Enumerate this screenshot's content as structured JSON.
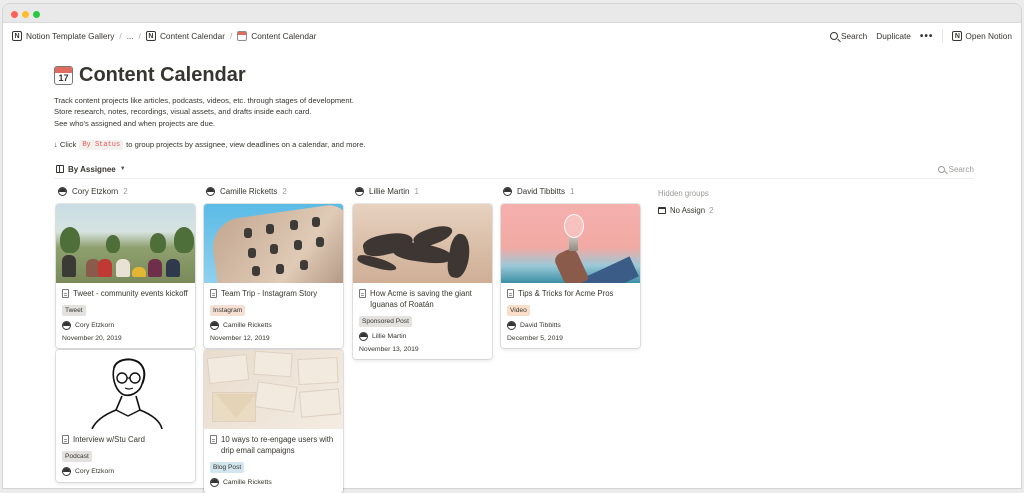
{
  "breadcrumbs": {
    "gallery": "Notion Template Gallery",
    "ellipsis": "...",
    "parent": "Content Calendar",
    "current": "Content Calendar"
  },
  "topbar": {
    "search": "Search",
    "duplicate": "Duplicate",
    "more": "•••",
    "open": "Open Notion"
  },
  "page": {
    "title": "Content Calendar",
    "desc1": "Track content projects like articles, podcasts, videos, etc. through stages of development.",
    "desc2": "Store research, notes, recordings, visual assets, and drafts inside each card.",
    "desc3": "See who's assigned and when projects are due.",
    "hint_prefix": "↓ Click",
    "hint_code": "By Status",
    "hint_suffix": "to group projects by assignee, view deadlines on a calendar, and more."
  },
  "view": {
    "name": "By Assignee",
    "search": "Search"
  },
  "columns": [
    {
      "name": "Cory Etzkorn",
      "count": "2",
      "cards": [
        {
          "title": "Tweet - community events kickoff",
          "tag": "Tweet",
          "tag_color": "#e3e2e0",
          "person": "Cory Etzkorn",
          "date": "November 20, 2019"
        },
        {
          "title": "Interview w/Stu Card",
          "tag": "Podcast",
          "tag_color": "#e3e2e0",
          "person": "Cory Etzkorn",
          "date": ""
        }
      ]
    },
    {
      "name": "Camille Ricketts",
      "count": "2",
      "cards": [
        {
          "title": "Team Trip - Instagram Story",
          "tag": "Instagram",
          "tag_color": "#f5e0d3",
          "person": "Camille Ricketts",
          "date": "November 12, 2019"
        },
        {
          "title": "10 ways to re-engage users with drip email campaigns",
          "tag": "Blog Post",
          "tag_color": "#d3e5ef",
          "person": "Camille Ricketts",
          "date": ""
        }
      ]
    },
    {
      "name": "Lillie Martin",
      "count": "1",
      "cards": [
        {
          "title": "How Acme is saving the giant Iguanas of Roatán",
          "tag": "Sponsored Post",
          "tag_color": "#e3e2e0",
          "person": "Lillie Martin",
          "date": "November 13, 2019"
        }
      ]
    },
    {
      "name": "David Tibbitts",
      "count": "1",
      "cards": [
        {
          "title": "Tips & Tricks for Acme Pros",
          "tag": "Video",
          "tag_color": "#fadec9",
          "person": "David Tibbitts",
          "date": "December 5, 2019"
        }
      ]
    }
  ],
  "hidden_groups": {
    "label": "Hidden groups",
    "no_assign": "No Assign",
    "no_assign_count": "2"
  }
}
